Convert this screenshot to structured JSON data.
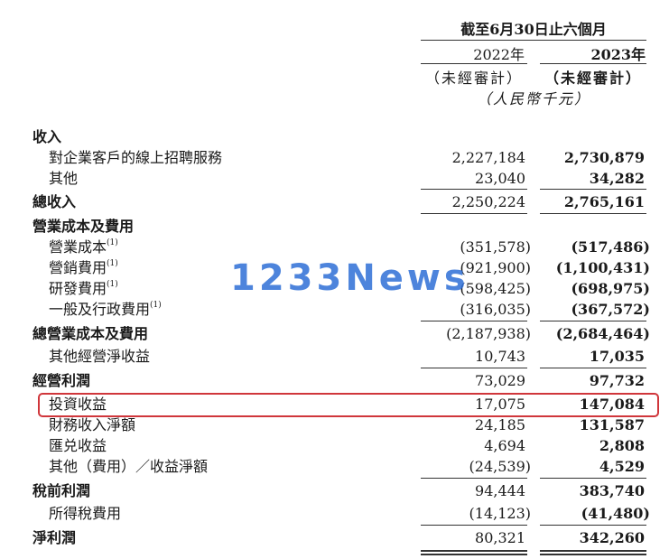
{
  "header": {
    "period": "截至6月30日止六個月",
    "year_2022": "2022年",
    "year_2023": "2023年",
    "audit_2022": "（未經審計）",
    "audit_2023": "（未經審計）",
    "unit": "（人民幣千元）"
  },
  "watermark": "1233News",
  "footnote_marker": "(1)",
  "rows": [
    {
      "label": "收入",
      "v2022": "",
      "v2023": ""
    },
    {
      "label": "對企業客戶的線上招聘服務",
      "v2022": "2,227,184",
      "v2023": "2,730,879"
    },
    {
      "label": "其他",
      "v2022": "23,040",
      "v2023": "34,282"
    },
    {
      "label": "總收入",
      "v2022": "2,250,224",
      "v2023": "2,765,161"
    },
    {
      "label": "營業成本及費用",
      "v2022": "",
      "v2023": ""
    },
    {
      "label": "營業成本",
      "v2022": "(351,578)",
      "v2023": "(517,486)"
    },
    {
      "label": "營銷費用",
      "v2022": "(921,900)",
      "v2023": "(1,100,431)"
    },
    {
      "label": "研發費用",
      "v2022": "(598,425)",
      "v2023": "(698,975)"
    },
    {
      "label": "一般及行政費用",
      "v2022": "(316,035)",
      "v2023": "(367,572)"
    },
    {
      "label": "總營業成本及費用",
      "v2022": "(2,187,938)",
      "v2023": "(2,684,464)"
    },
    {
      "label": "其他經營淨收益",
      "v2022": "10,743",
      "v2023": "17,035"
    },
    {
      "label": "經營利潤",
      "v2022": "73,029",
      "v2023": "97,732"
    },
    {
      "label": "投資收益",
      "v2022": "17,075",
      "v2023": "147,084"
    },
    {
      "label": "財務收入淨額",
      "v2022": "24,185",
      "v2023": "131,587"
    },
    {
      "label": "匯兑收益",
      "v2022": "4,694",
      "v2023": "2,808"
    },
    {
      "label": "其他（費用）／收益淨額",
      "v2022": "(24,539)",
      "v2023": "4,529"
    },
    {
      "label": "稅前利潤",
      "v2022": "94,444",
      "v2023": "383,740"
    },
    {
      "label": "所得稅費用",
      "v2022": "(14,123)",
      "v2023": "(41,480)"
    },
    {
      "label": "淨利潤",
      "v2022": "80,321",
      "v2023": "342,260"
    }
  ]
}
